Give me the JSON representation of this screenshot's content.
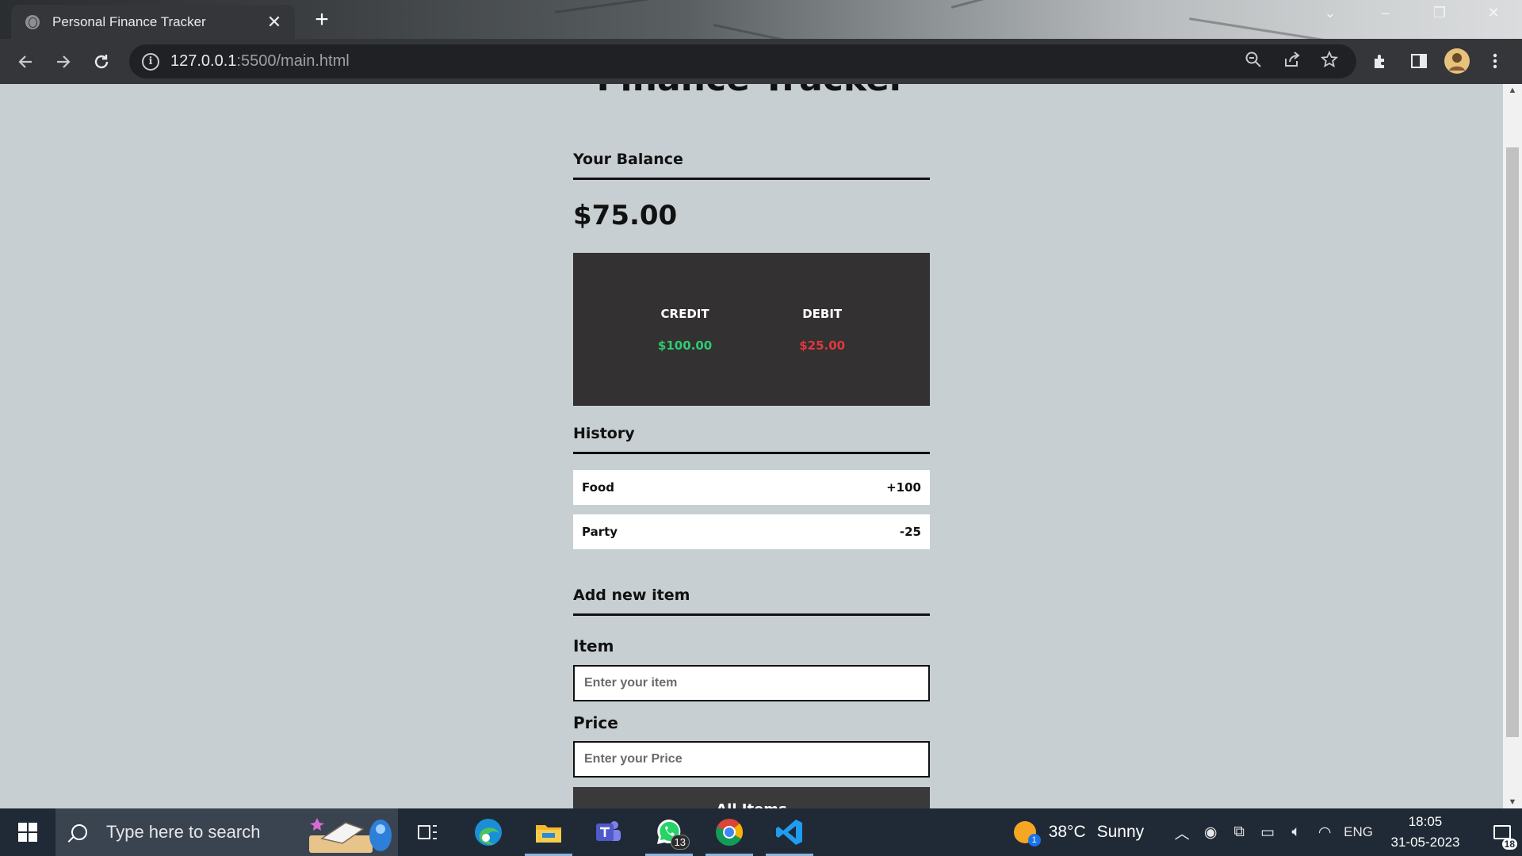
{
  "browser": {
    "tab_title": "Personal Finance Tracker",
    "tab_close": "✕",
    "new_tab": "+",
    "url_host": "127.0.0.1",
    "url_path": ":5500/main.html"
  },
  "page": {
    "heading": "Finance Tracker",
    "balance_title": "Your Balance",
    "balance_amount": "$75.00",
    "credit_label": "CREDIT",
    "credit_amount": "$100.00",
    "debit_label": "DEBIT",
    "debit_amount": "$25.00",
    "history_title": "History",
    "history": [
      {
        "name": "Food",
        "amount": "+100"
      },
      {
        "name": "Party",
        "amount": "-25"
      }
    ],
    "add_title": "Add new item",
    "item_label": "Item",
    "item_placeholder": "Enter your item",
    "price_label": "Price",
    "price_placeholder": "Enter your Price",
    "submit_label": "All Items"
  },
  "taskbar": {
    "search_placeholder": "Type here to search",
    "whatsapp_badge": "13",
    "weather_temp": "38°C",
    "weather_desc": "Sunny",
    "weather_badge": "1",
    "language": "ENG",
    "time": "18:05",
    "date": "31-05-2023",
    "notification_count": "18"
  },
  "colors": {
    "page_bg": "#c7cfd2",
    "card_bg": "#333131",
    "credit": "#2ecc71",
    "debit": "#e0383e"
  }
}
